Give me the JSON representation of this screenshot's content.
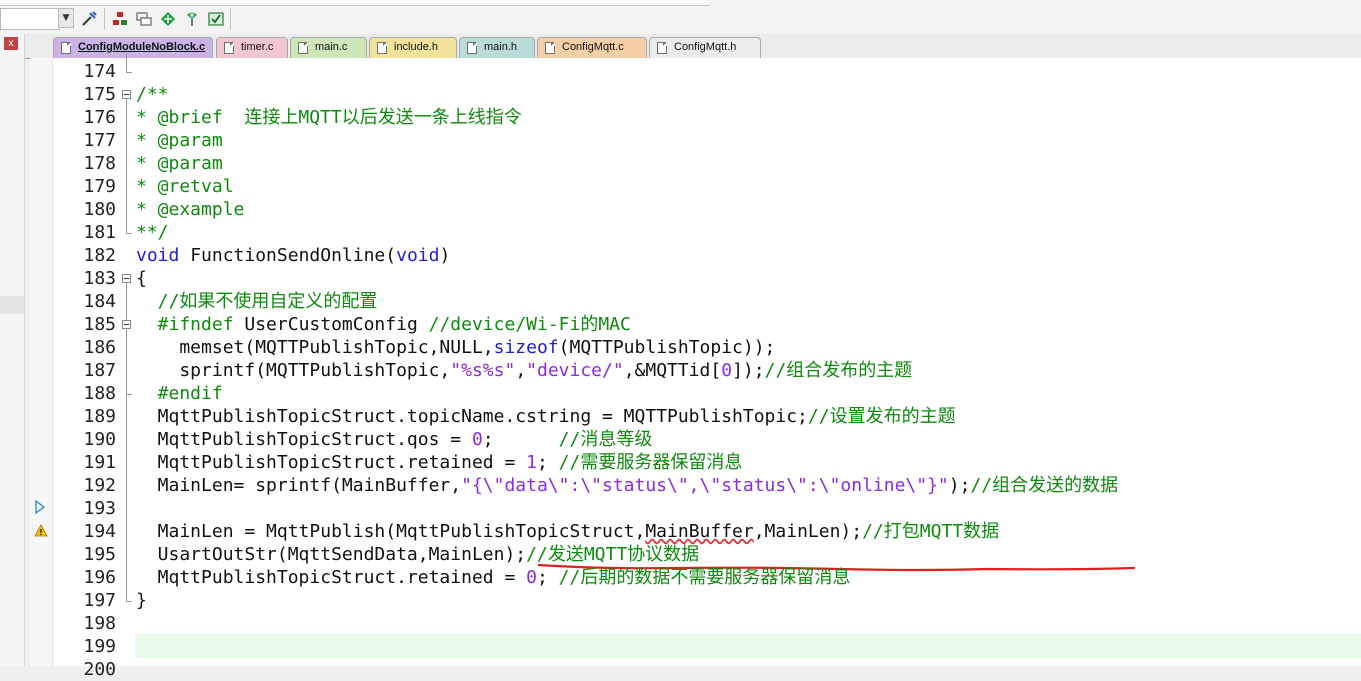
{
  "tabs": [
    {
      "label": "ConfigModuleNoBlock.c",
      "active": true,
      "color": "#cbb3e8"
    },
    {
      "label": "timer.c",
      "active": false,
      "color": "#f2c7cf"
    },
    {
      "label": "main.c",
      "active": false,
      "color": "#cfe6b8"
    },
    {
      "label": "include.h",
      "active": false,
      "color": "#f2e29a"
    },
    {
      "label": "main.h",
      "active": false,
      "color": "#b9dcd8"
    },
    {
      "label": "ConfigMqtt.c",
      "active": false,
      "color": "#f6cfa6"
    },
    {
      "label": "ConfigMqtt.h",
      "active": false,
      "color": "#ececec"
    }
  ],
  "toolbar": {
    "icons": [
      "dropdown-icon",
      "build-tools-icon",
      "module-icon",
      "window-stack-icon",
      "diamond-icon",
      "pin-icon",
      "settings-check-icon"
    ]
  },
  "left_strip": {
    "close_label": "x"
  },
  "code_lines": [
    {
      "num": "174",
      "segments": []
    },
    {
      "num": "175",
      "segments": [
        {
          "t": "/**",
          "c": "com"
        }
      ]
    },
    {
      "num": "176",
      "segments": [
        {
          "t": "* @brief  连接上MQTT以后发送一条上线指令",
          "c": "com"
        }
      ]
    },
    {
      "num": "177",
      "segments": [
        {
          "t": "* @param",
          "c": "com"
        }
      ]
    },
    {
      "num": "178",
      "segments": [
        {
          "t": "* @param",
          "c": "com"
        }
      ]
    },
    {
      "num": "179",
      "segments": [
        {
          "t": "* @retval",
          "c": "com"
        }
      ]
    },
    {
      "num": "180",
      "segments": [
        {
          "t": "* @example",
          "c": "com"
        }
      ]
    },
    {
      "num": "181",
      "segments": [
        {
          "t": "**/",
          "c": "com"
        }
      ]
    },
    {
      "num": "182",
      "segments": [
        {
          "t": "void",
          "c": "kw"
        },
        {
          "t": " FunctionSendOnline(",
          "c": ""
        },
        {
          "t": "void",
          "c": "kw"
        },
        {
          "t": ")",
          "c": ""
        }
      ]
    },
    {
      "num": "183",
      "segments": [
        {
          "t": "{",
          "c": ""
        }
      ]
    },
    {
      "num": "184",
      "segments": [
        {
          "t": "  //如果不使用自定义的配置",
          "c": "com"
        }
      ]
    },
    {
      "num": "185",
      "segments": [
        {
          "t": "  #ifndef",
          "c": "pp"
        },
        {
          "t": " UserCustomConfig ",
          "c": ""
        },
        {
          "t": "//device/Wi-Fi的MAC",
          "c": "com"
        }
      ]
    },
    {
      "num": "186",
      "segments": [
        {
          "t": "    memset(MQTTPublishTopic,NULL,",
          "c": ""
        },
        {
          "t": "sizeof",
          "c": "kw"
        },
        {
          "t": "(MQTTPublishTopic));",
          "c": ""
        }
      ]
    },
    {
      "num": "187",
      "segments": [
        {
          "t": "    sprintf(MQTTPublishTopic,",
          "c": ""
        },
        {
          "t": "\"%s%s\"",
          "c": "str"
        },
        {
          "t": ",",
          "c": ""
        },
        {
          "t": "\"device/\"",
          "c": "str"
        },
        {
          "t": ",&MQTTid[",
          "c": ""
        },
        {
          "t": "0",
          "c": "num"
        },
        {
          "t": "]);",
          "c": ""
        },
        {
          "t": "//组合发布的主题",
          "c": "com"
        }
      ]
    },
    {
      "num": "188",
      "segments": [
        {
          "t": "  #endif",
          "c": "pp"
        }
      ]
    },
    {
      "num": "189",
      "segments": [
        {
          "t": "  MqttPublishTopicStruct.topicName.cstring = MQTTPublishTopic;",
          "c": ""
        },
        {
          "t": "//设置发布的主题",
          "c": "com"
        }
      ]
    },
    {
      "num": "190",
      "segments": [
        {
          "t": "  MqttPublishTopicStruct.qos = ",
          "c": ""
        },
        {
          "t": "0",
          "c": "num"
        },
        {
          "t": ";      ",
          "c": ""
        },
        {
          "t": "//消息等级",
          "c": "com"
        }
      ]
    },
    {
      "num": "191",
      "segments": [
        {
          "t": "  MqttPublishTopicStruct.retained = ",
          "c": ""
        },
        {
          "t": "1",
          "c": "num"
        },
        {
          "t": "; ",
          "c": ""
        },
        {
          "t": "//需要服务器保留消息",
          "c": "com"
        }
      ]
    },
    {
      "num": "192",
      "segments": [
        {
          "t": "  MainLen= sprintf(MainBuffer,",
          "c": ""
        },
        {
          "t": "\"{\\\"data\\\":\\\"status\\\",\\\"status\\\":\\\"online\\\"}\"",
          "c": "str"
        },
        {
          "t": ");",
          "c": ""
        },
        {
          "t": "//组合发送的数据",
          "c": "com"
        }
      ]
    },
    {
      "num": "193",
      "segments": []
    },
    {
      "num": "194",
      "segments": [
        {
          "t": "  MainLen = MqttPublish(MqttPublishTopicStruct,",
          "c": ""
        },
        {
          "t": "MainBuffer",
          "c": "squig"
        },
        {
          "t": ",MainLen);",
          "c": ""
        },
        {
          "t": "//打包MQTT数据",
          "c": "com"
        }
      ]
    },
    {
      "num": "195",
      "segments": [
        {
          "t": "  UsartOutStr(MqttSendData,MainLen);",
          "c": ""
        },
        {
          "t": "//发送MQTT协议数据",
          "c": "com"
        }
      ]
    },
    {
      "num": "196",
      "segments": [
        {
          "t": "  MqttPublishTopicStruct.retained = ",
          "c": ""
        },
        {
          "t": "0",
          "c": "num"
        },
        {
          "t": "; ",
          "c": ""
        },
        {
          "t": "//后期的数据不需要服务器保留消息",
          "c": "com"
        }
      ]
    },
    {
      "num": "197",
      "segments": [
        {
          "t": "}",
          "c": ""
        }
      ]
    },
    {
      "num": "198",
      "segments": []
    },
    {
      "num": "199",
      "segments": []
    },
    {
      "num": "200",
      "segments": []
    }
  ]
}
